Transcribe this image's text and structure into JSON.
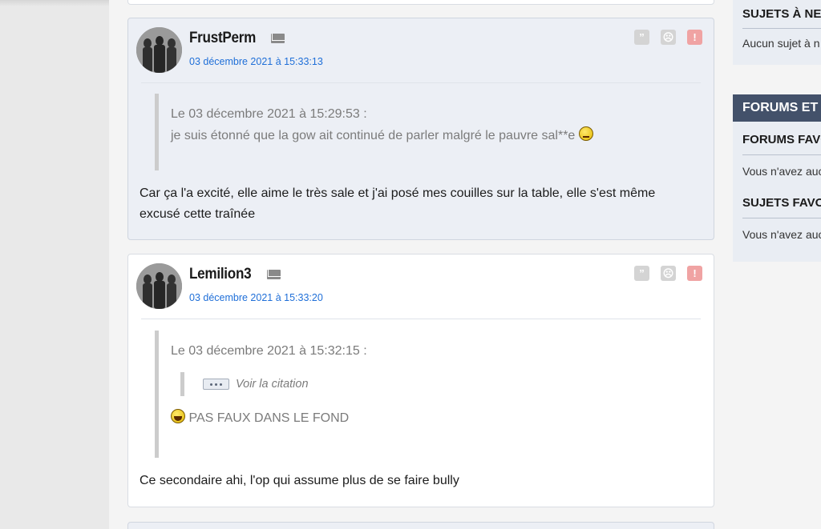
{
  "posts": [
    {
      "author": "FrustPerm",
      "date": "03 décembre 2021 à 15:33:13",
      "quote_header": "Le 03 décembre 2021 à 15:29:53 :",
      "quote_text": "je suis étonné que la gow ait continué de parler malgré le pauvre sal**e",
      "body_line1": "Car ça l'a excité, elle aime le très sale et j'ai posé mes couilles sur la table, elle s'est même",
      "body_line2": "excusé cette traînée"
    },
    {
      "author": "Lemilion3",
      "date": "03 décembre 2021 à 15:33:20",
      "quote_header": "Le 03 décembre 2021 à 15:32:15 :",
      "nested_quote_label": "Voir la citation",
      "quote_text": "PAS FAUX DANS LE FOND",
      "body_line1": "Ce secondaire ahi, l'op qui assume plus de se faire bully"
    }
  ],
  "post_actions": {
    "quote_symbol": "”",
    "sad_symbol": "☹",
    "alert_symbol": "!"
  },
  "sidebar": {
    "box1_title": "SUJETS À NE P",
    "box1_text": "Aucun sujet à n",
    "box2_title": "FORUMS ET S",
    "box2_sub1": "FORUMS FAVO",
    "box2_text1": "Vous n'avez auc",
    "box2_sub2": "SUJETS FAVOR",
    "box2_text2": "Vous n'avez auc"
  },
  "colors": {
    "link": "#1f6fd8",
    "sidebar_header": "#43516a",
    "alert": "#f0a3a3"
  },
  "icons": [
    "mail-icon",
    "quote-icon",
    "sad-face-icon",
    "alert-icon",
    "avatar-silhouettes"
  ]
}
